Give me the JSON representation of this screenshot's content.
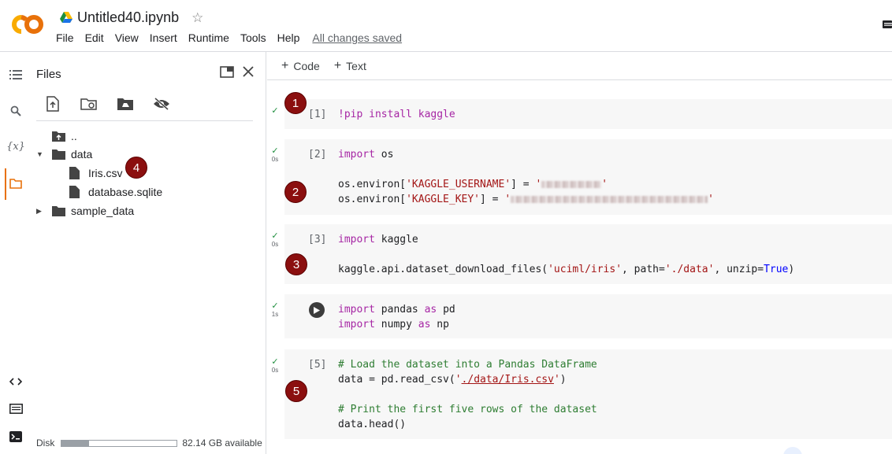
{
  "header": {
    "title": "Untitled40.ipynb",
    "menu": [
      "File",
      "Edit",
      "View",
      "Insert",
      "Runtime",
      "Tools",
      "Help"
    ],
    "save_status": "All changes saved",
    "brand_colors": {
      "logo_orange": "#f9ab00",
      "logo_dark": "#e8710a"
    }
  },
  "rail": {
    "icons": [
      "table-of-contents-icon",
      "search-icon",
      "variables-icon",
      "folder-icon",
      "code-snippets-icon",
      "command-palette-icon",
      "terminal-icon"
    ],
    "variables_label": "{x}"
  },
  "files_panel": {
    "title": "Files",
    "toolbar_icons": [
      "upload-icon",
      "refresh-icon",
      "mount-drive-icon",
      "hide-files-icon"
    ],
    "tree": {
      "parent": "..",
      "data_folder": "data",
      "iris_csv": "Iris.csv",
      "database": "database.sqlite",
      "sample_data": "sample_data"
    },
    "disk": {
      "label": "Disk",
      "available": "82.14 GB available",
      "used_fraction": 0.24
    }
  },
  "notebook": {
    "add_code": "Code",
    "add_text": "Text",
    "cells": [
      {
        "count": "[1]",
        "elapsed": "",
        "line1": "!pip install kaggle"
      },
      {
        "count": "[2]",
        "elapsed": "0s",
        "l1_kw": "import",
        "l1_rest": " os",
        "l3_a": "os.environ[",
        "l3_str": "'KAGGLE_USERNAME'",
        "l3_b": "] = ",
        "l3_q": "'",
        "l4_a": "os.environ[",
        "l4_str": "'KAGGLE_KEY'",
        "l4_b": "] = ",
        "l4_q": "'"
      },
      {
        "count": "[3]",
        "elapsed": "0s",
        "l1_kw": "import",
        "l1_rest": " kaggle",
        "l3_a": "kaggle.api.dataset_download_files(",
        "l3_s1": "'uciml/iris'",
        "l3_b": ", path=",
        "l3_s2": "'./data'",
        "l3_c": ", unzip=",
        "l3_bool": "True",
        "l3_d": ")"
      },
      {
        "count": "",
        "elapsed": "1s",
        "l1_kw": "import",
        "l1_mid": " pandas ",
        "l1_as": "as",
        "l1_end": " pd",
        "l2_kw": "import",
        "l2_mid": " numpy ",
        "l2_as": "as",
        "l2_end": " np"
      },
      {
        "count": "[5]",
        "elapsed": "0s",
        "c1": "# Load the dataset into a Pandas DataFrame",
        "l2_a": "data = pd.read_csv(",
        "l2_q1": "'",
        "l2_link": "./data/Iris.csv",
        "l2_q2": "'",
        "l2_b": ")",
        "c2": "# Print the first five rows of the dataset",
        "l5": "data.head()"
      }
    ]
  },
  "annotations": [
    "1",
    "2",
    "3",
    "4",
    "5"
  ]
}
